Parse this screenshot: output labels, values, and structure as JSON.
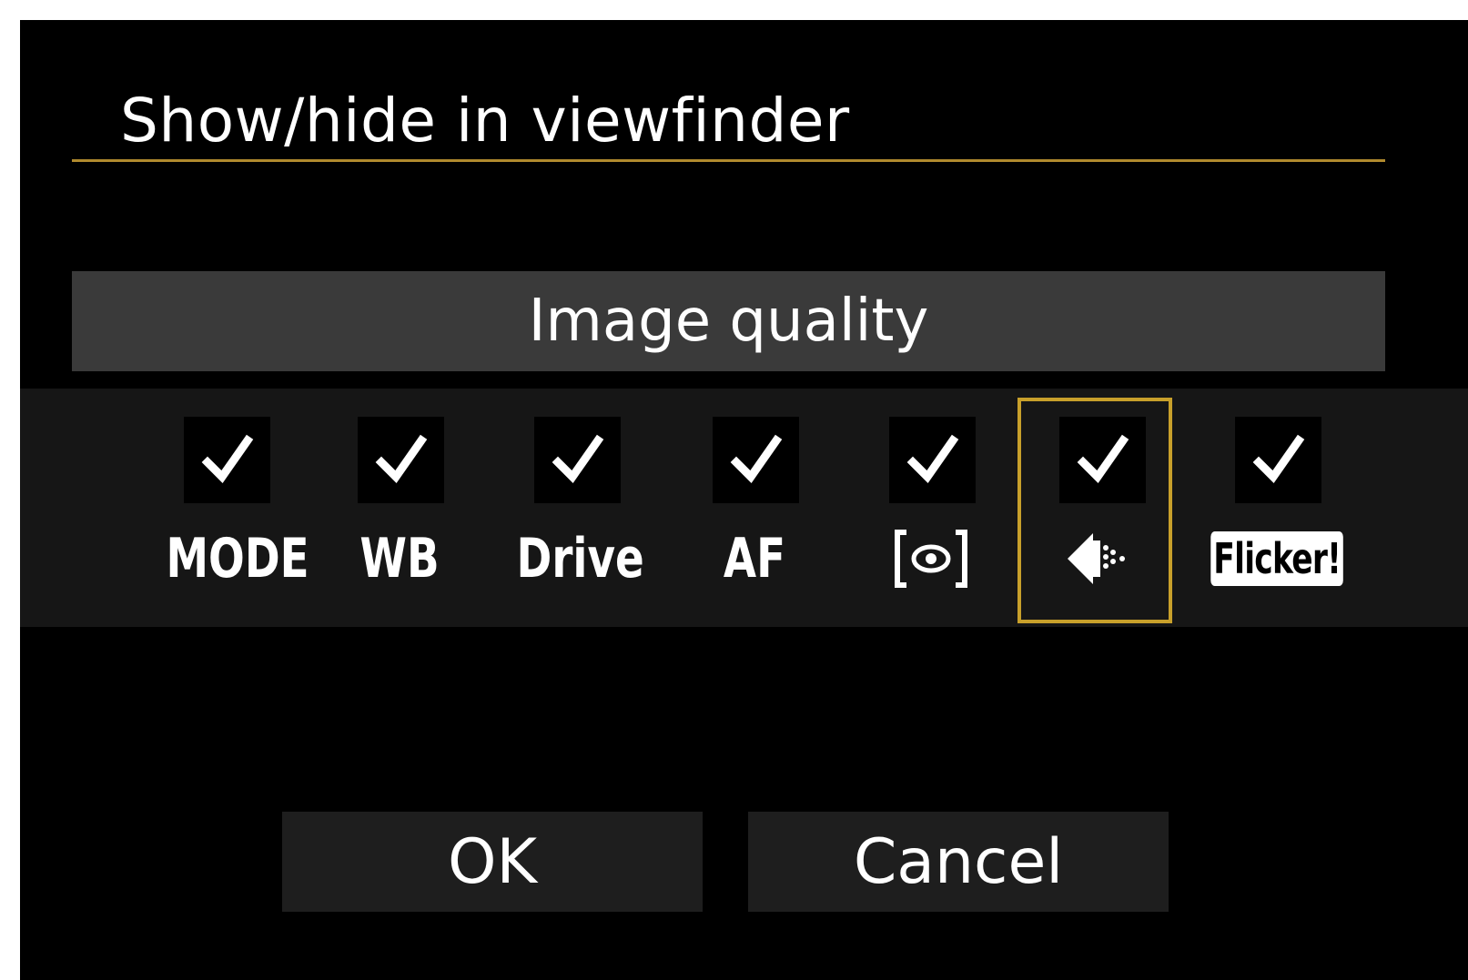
{
  "screen": {
    "title": "Show/hide in viewfinder",
    "selected_item_name": "Image quality"
  },
  "items": [
    {
      "label": "MODE",
      "checked": true,
      "icon": null
    },
    {
      "label": "WB",
      "checked": true,
      "icon": null
    },
    {
      "label": "Drive",
      "checked": true,
      "icon": null
    },
    {
      "label": "AF",
      "checked": true,
      "icon": null
    },
    {
      "label": null,
      "checked": true,
      "icon": "metering-icon"
    },
    {
      "label": null,
      "checked": true,
      "icon": "image-quality-icon"
    },
    {
      "label": "Flicker!",
      "checked": true,
      "icon": "flicker-badge"
    }
  ],
  "selected_index": 5,
  "buttons": {
    "ok_label": "OK",
    "cancel_label": "Cancel"
  },
  "colors": {
    "accent": "#c8a02b",
    "rule": "#b08a2e",
    "background": "#000000",
    "label_bar": "#3a3a3a",
    "strip": "#161616",
    "button": "#1e1e1e"
  }
}
